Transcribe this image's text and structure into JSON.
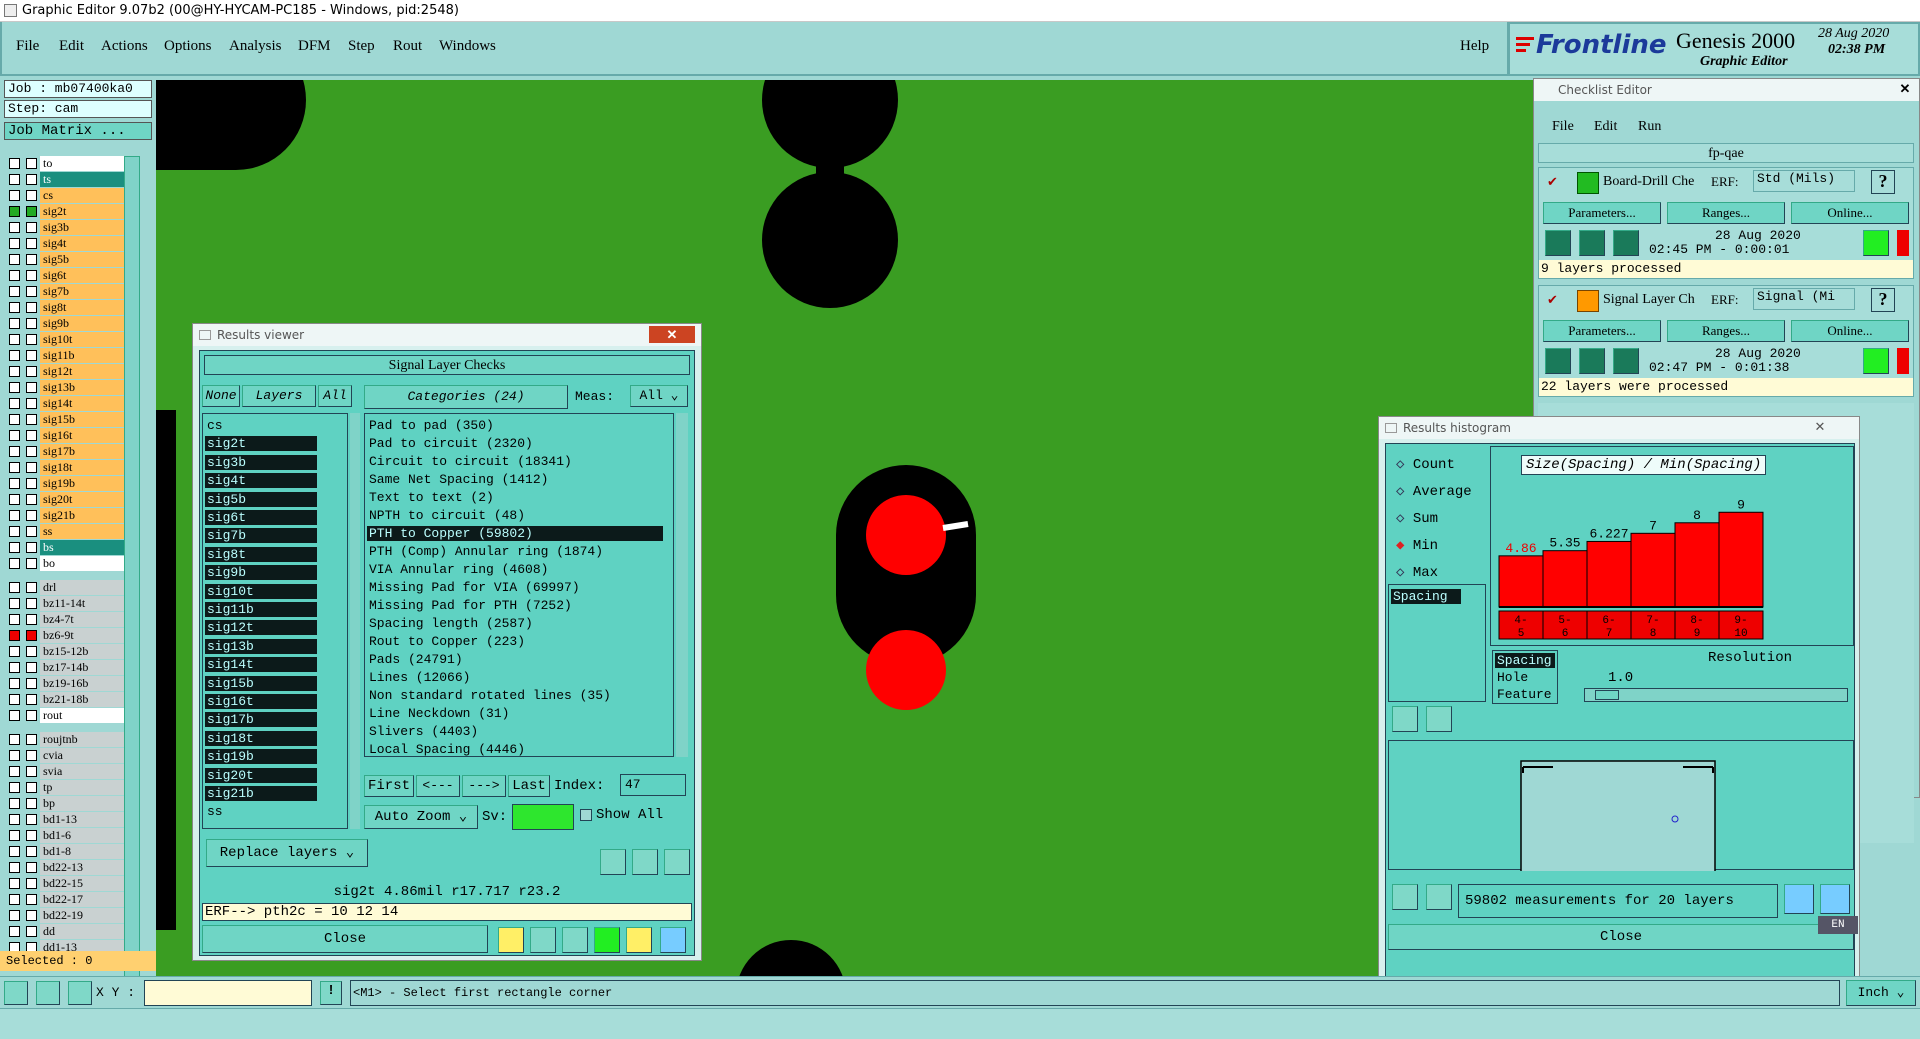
{
  "window": {
    "title": "Graphic Editor 9.07b2 (00@HY-HYCAM-PC185 - Windows, pid:2548)"
  },
  "menu": [
    "File",
    "Edit",
    "Actions",
    "Options",
    "Analysis",
    "DFM",
    "Step",
    "Rout",
    "Windows"
  ],
  "help": "Help",
  "brand": {
    "logo": "Frontline",
    "product": "Genesis 2000",
    "subtitle": "Graphic Editor",
    "date": "28 Aug 2020",
    "time": "02:38 PM"
  },
  "job": {
    "job": "Job : mb07400ka0",
    "step": "Step: cam",
    "matrix": "Job Matrix ..."
  },
  "layers": [
    {
      "name": "to",
      "color": "wh",
      "cb": ""
    },
    {
      "name": "ts",
      "color": "tl",
      "cb": ""
    },
    {
      "name": "cs",
      "color": "or",
      "cb": ""
    },
    {
      "name": "sig2t",
      "color": "or",
      "cb": "active"
    },
    {
      "name": "sig3b",
      "color": "or",
      "cb": ""
    },
    {
      "name": "sig4t",
      "color": "or",
      "cb": ""
    },
    {
      "name": "sig5b",
      "color": "or",
      "cb": ""
    },
    {
      "name": "sig6t",
      "color": "or",
      "cb": ""
    },
    {
      "name": "sig7b",
      "color": "or",
      "cb": ""
    },
    {
      "name": "sig8t",
      "color": "or",
      "cb": ""
    },
    {
      "name": "sig9b",
      "color": "or",
      "cb": ""
    },
    {
      "name": "sig10t",
      "color": "or",
      "cb": ""
    },
    {
      "name": "sig11b",
      "color": "or",
      "cb": ""
    },
    {
      "name": "sig12t",
      "color": "or",
      "cb": ""
    },
    {
      "name": "sig13b",
      "color": "or",
      "cb": ""
    },
    {
      "name": "sig14t",
      "color": "or",
      "cb": ""
    },
    {
      "name": "sig15b",
      "color": "or",
      "cb": ""
    },
    {
      "name": "sig16t",
      "color": "or",
      "cb": ""
    },
    {
      "name": "sig17b",
      "color": "or",
      "cb": ""
    },
    {
      "name": "sig18t",
      "color": "or",
      "cb": ""
    },
    {
      "name": "sig19b",
      "color": "or",
      "cb": ""
    },
    {
      "name": "sig20t",
      "color": "or",
      "cb": ""
    },
    {
      "name": "sig21b",
      "color": "or",
      "cb": ""
    },
    {
      "name": "ss",
      "color": "or",
      "cb": ""
    },
    {
      "name": "bs",
      "color": "tl",
      "cb": ""
    },
    {
      "name": "bo",
      "color": "wh",
      "cb": ""
    }
  ],
  "layers2": [
    {
      "name": "drl",
      "color": "gr",
      "cb": ""
    },
    {
      "name": "bz11-14t",
      "color": "gr",
      "cb": ""
    },
    {
      "name": "bz4-7t",
      "color": "gr",
      "cb": ""
    },
    {
      "name": "bz6-9t",
      "color": "gr",
      "cb": "red"
    },
    {
      "name": "bz15-12b",
      "color": "gr",
      "cb": ""
    },
    {
      "name": "bz17-14b",
      "color": "gr",
      "cb": ""
    },
    {
      "name": "bz19-16b",
      "color": "gr",
      "cb": ""
    },
    {
      "name": "bz21-18b",
      "color": "gr",
      "cb": ""
    },
    {
      "name": "rout",
      "color": "wh",
      "cb": ""
    }
  ],
  "layers3": [
    {
      "name": "roujtnb",
      "color": "gr",
      "cb": ""
    },
    {
      "name": "cvia",
      "color": "gr",
      "cb": ""
    },
    {
      "name": "svia",
      "color": "gr",
      "cb": ""
    },
    {
      "name": "tp",
      "color": "gr",
      "cb": ""
    },
    {
      "name": "bp",
      "color": "gr",
      "cb": ""
    },
    {
      "name": "bd1-13",
      "color": "gr",
      "cb": ""
    },
    {
      "name": "bd1-6",
      "color": "gr",
      "cb": ""
    },
    {
      "name": "bd1-8",
      "color": "gr",
      "cb": ""
    },
    {
      "name": "bd22-13",
      "color": "gr",
      "cb": ""
    },
    {
      "name": "bd22-15",
      "color": "gr",
      "cb": ""
    },
    {
      "name": "bd22-17",
      "color": "gr",
      "cb": ""
    },
    {
      "name": "bd22-19",
      "color": "gr",
      "cb": ""
    },
    {
      "name": "dd",
      "color": "gr",
      "cb": ""
    },
    {
      "name": "dd1-13",
      "color": "gr",
      "cb": ""
    }
  ],
  "selected": "Selected : 0",
  "cmd": {
    "xy_label": "X Y :",
    "xy_value": "",
    "prompt": "<M1> - Select first rectangle corner",
    "unit": "Inch"
  },
  "results": {
    "title": "Results viewer",
    "heading": "Signal Layer Checks",
    "none": "None",
    "layers": "Layers",
    "all": "All",
    "categories": "Categories (24)",
    "meas": "Meas:",
    "meas_val": "All",
    "layer_list": [
      "cs",
      "sig2t",
      "sig3b",
      "sig4t",
      "sig5b",
      "sig6t",
      "sig7b",
      "sig8t",
      "sig9b",
      "sig10t",
      "sig11b",
      "sig12t",
      "sig13b",
      "sig14t",
      "sig15b",
      "sig16t",
      "sig17b",
      "sig18t",
      "sig19b",
      "sig20t",
      "sig21b",
      "ss"
    ],
    "cat_list": [
      "Pad to pad (350)",
      "Pad to circuit (2320)",
      "Circuit to circuit (18341)",
      "Same Net Spacing (1412)",
      "Text to text (2)",
      "NPTH to circuit (48)",
      "PTH to Copper (59802)",
      "PTH (Comp) Annular ring (1874)",
      "VIA Annular ring (4608)",
      "Missing Pad for VIA (69997)",
      "Missing Pad for PTH (7252)",
      "Spacing length (2587)",
      "Rout to Copper (223)",
      "Pads (24791)",
      "Lines (12066)",
      "Non standard rotated lines (35)",
      "Line Neckdown (31)",
      "Slivers (4403)",
      "Local Spacing (4446)"
    ],
    "first": "First",
    "prev": "<---",
    "next": "--->",
    "last": "Last",
    "index_label": "Index:",
    "index": "47",
    "autozoom": "Auto Zoom",
    "sv": "Sv:",
    "showall": "Show All",
    "replace": "Replace layers",
    "status": "sig2t 4.86mil  r17.717  r23.2",
    "erf": "ERF--> pth2c = 10 12 14",
    "close": "Close",
    "def": "DEF",
    "ref": "REF",
    "undo": "UNDO"
  },
  "checklist": {
    "title": "Checklist Editor",
    "menu": [
      "File",
      "Edit",
      "Run"
    ],
    "name": "fp-qae",
    "item1": {
      "name": "Board-Drill Che",
      "erf": "ERF:",
      "erfval": "Std (Mils)",
      "date": "28 Aug 2020",
      "time": "02:45 PM - 0:00:01",
      "msg": "9 layers processed"
    },
    "item2": {
      "name": "Signal Layer Ch",
      "erf": "ERF:",
      "erfval": "Signal (Mi",
      "date": "28 Aug 2020",
      "time": "02:47 PM - 0:01:38",
      "msg": "22 layers were processed"
    },
    "params": "Parameters...",
    "ranges": "Ranges...",
    "online": "Online..."
  },
  "histogram": {
    "title": "Results histogram",
    "stats": [
      "Count",
      "Average",
      "Sum",
      "Min",
      "Max"
    ],
    "selected_stat": "Min",
    "heading": "Size(Spacing) / Min(Spacing)",
    "list": [
      "Spacing"
    ],
    "types": [
      "Spacing",
      "Hole",
      "Feature"
    ],
    "resolution_label": "Resolution",
    "resolution": "1.0",
    "footer": "59802 measurements for 20 layers",
    "close": "Close",
    "def": "DEF",
    "ref": "REF",
    "lang": "EN"
  },
  "chart_data": {
    "type": "bar",
    "categories": [
      "4-5",
      "5-6",
      "6-7",
      "7-8",
      "8-9",
      "9-10"
    ],
    "values": [
      4.86,
      5.35,
      6.227,
      7,
      8,
      9
    ],
    "labels": [
      "4.86",
      "5.35",
      "6.227",
      "7",
      "8",
      "9"
    ],
    "title": "Size(Spacing) / Min(Spacing)",
    "bar_color": "#ff0000",
    "highlight_color": "#ff0000"
  }
}
